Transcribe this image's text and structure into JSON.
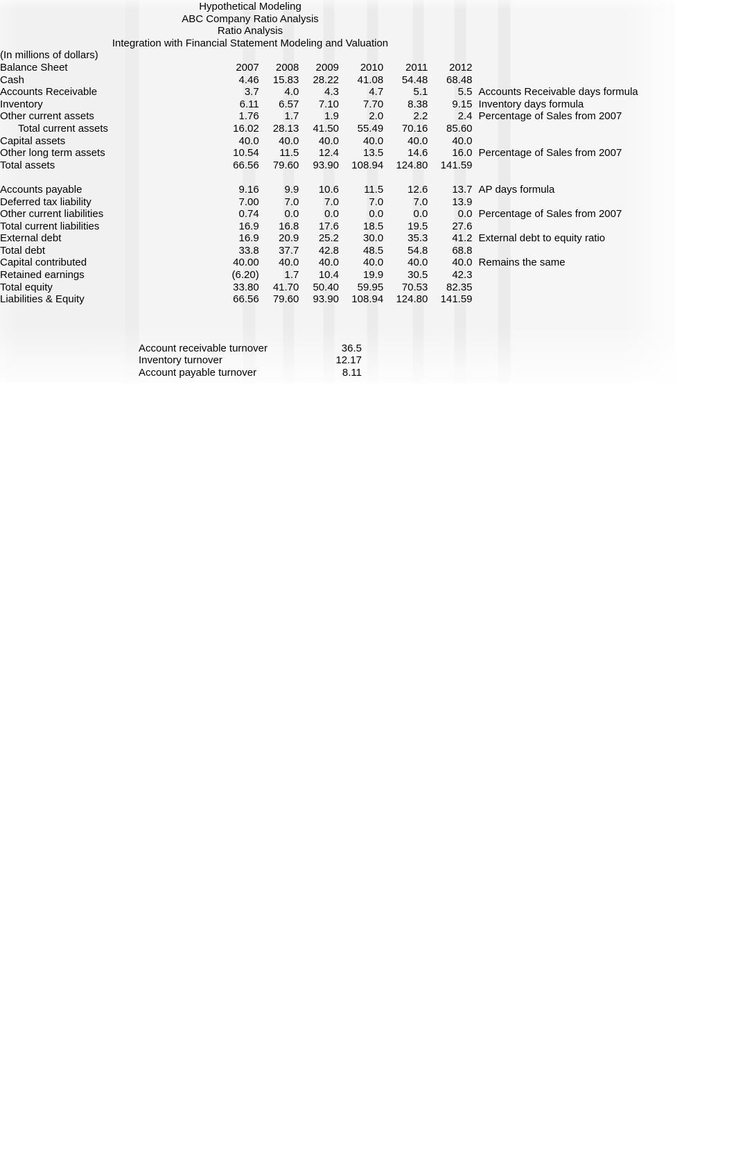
{
  "document": {
    "titles": [
      "Hypothetical Modeling",
      "ABC Company Ratio Analysis",
      "Ratio Analysis",
      "Integration with Financial Statement Modeling and Valuation"
    ],
    "units_note": "(In millions of dollars)"
  },
  "chart_data": {
    "type": "table",
    "title": "ABC Company Ratio Analysis - Balance Sheet",
    "subtitle": "Integration with Financial Statement Modeling and Valuation",
    "units": "(In millions of dollars)",
    "row_header_label": "Balance Sheet",
    "categories": [
      "2007",
      "2008",
      "2009",
      "2010",
      "2011",
      "2012"
    ],
    "note_column_header": "",
    "rows": [
      {
        "label": "Cash",
        "indent": false,
        "values": [
          "4.46",
          "15.83",
          "28.22",
          "41.08",
          "54.48",
          "68.48"
        ],
        "note": ""
      },
      {
        "label": "Accounts Receivable",
        "indent": false,
        "values": [
          "3.7",
          "4.0",
          "4.3",
          "4.7",
          "5.1",
          "5.5"
        ],
        "note": "Accounts Receivable days formula"
      },
      {
        "label": "Inventory",
        "indent": false,
        "values": [
          "6.11",
          "6.57",
          "7.10",
          "7.70",
          "8.38",
          "9.15"
        ],
        "note": "Inventory days formula"
      },
      {
        "label": "Other current assets",
        "indent": false,
        "values": [
          "1.76",
          "1.7",
          "1.9",
          "2.0",
          "2.2",
          "2.4"
        ],
        "note": "Percentage of Sales from 2007"
      },
      {
        "label": "Total current assets",
        "indent": true,
        "values": [
          "16.02",
          "28.13",
          "41.50",
          "55.49",
          "70.16",
          "85.60"
        ],
        "note": ""
      },
      {
        "label": "Capital assets",
        "indent": false,
        "values": [
          "40.0",
          "40.0",
          "40.0",
          "40.0",
          "40.0",
          "40.0"
        ],
        "note": ""
      },
      {
        "label": "Other long term assets",
        "indent": false,
        "values": [
          "10.54",
          "11.5",
          "12.4",
          "13.5",
          "14.6",
          "16.0"
        ],
        "note": "Percentage of Sales from 2007"
      },
      {
        "label": "Total assets",
        "indent": false,
        "values": [
          "66.56",
          "79.60",
          "93.90",
          "108.94",
          "124.80",
          "141.59"
        ],
        "note": ""
      },
      {
        "label": "",
        "indent": false,
        "values": [
          "",
          "",
          "",
          "",
          "",
          ""
        ],
        "note": ""
      },
      {
        "label": "Accounts payable",
        "indent": false,
        "values": [
          "9.16",
          "9.9",
          "10.6",
          "11.5",
          "12.6",
          "13.7"
        ],
        "note": "AP days formula"
      },
      {
        "label": "Deferred tax liability",
        "indent": false,
        "values": [
          "7.00",
          "7.0",
          "7.0",
          "7.0",
          "7.0",
          "13.9"
        ],
        "note": ""
      },
      {
        "label": "Other current liabilities",
        "indent": false,
        "values": [
          "0.74",
          "0.0",
          "0.0",
          "0.0",
          "0.0",
          "0.0"
        ],
        "note": "Percentage of Sales from 2007"
      },
      {
        "label": "Total current liabilities",
        "indent": false,
        "values": [
          "16.9",
          "16.8",
          "17.6",
          "18.5",
          "19.5",
          "27.6"
        ],
        "note": ""
      },
      {
        "label": "External debt",
        "indent": false,
        "values": [
          "16.9",
          "20.9",
          "25.2",
          "30.0",
          "35.3",
          "41.2"
        ],
        "note": "External debt to equity ratio"
      },
      {
        "label": "Total debt",
        "indent": false,
        "values": [
          "33.8",
          "37.7",
          "42.8",
          "48.5",
          "54.8",
          "68.8"
        ],
        "note": ""
      },
      {
        "label": "Capital contributed",
        "indent": false,
        "values": [
          "40.00",
          "40.0",
          "40.0",
          "40.0",
          "40.0",
          "40.0"
        ],
        "note": "Remains the same"
      },
      {
        "label": "Retained earnings",
        "indent": false,
        "values": [
          "(6.20)",
          "1.7",
          "10.4",
          "19.9",
          "30.5",
          "42.3"
        ],
        "note": ""
      },
      {
        "label": "Total equity",
        "indent": false,
        "values": [
          "33.80",
          "41.70",
          "50.40",
          "59.95",
          "70.53",
          "82.35"
        ],
        "note": ""
      },
      {
        "label": "Liabilities & Equity",
        "indent": false,
        "values": [
          "66.56",
          "79.60",
          "93.90",
          "108.94",
          "124.80",
          "141.59"
        ],
        "note": ""
      }
    ],
    "turnover_ratios": [
      {
        "label": "Account receivable turnover",
        "value": "36.5"
      },
      {
        "label": "Inventory turnover",
        "value": "12.17"
      },
      {
        "label": "Account payable turnover",
        "value": "8.11"
      }
    ]
  }
}
